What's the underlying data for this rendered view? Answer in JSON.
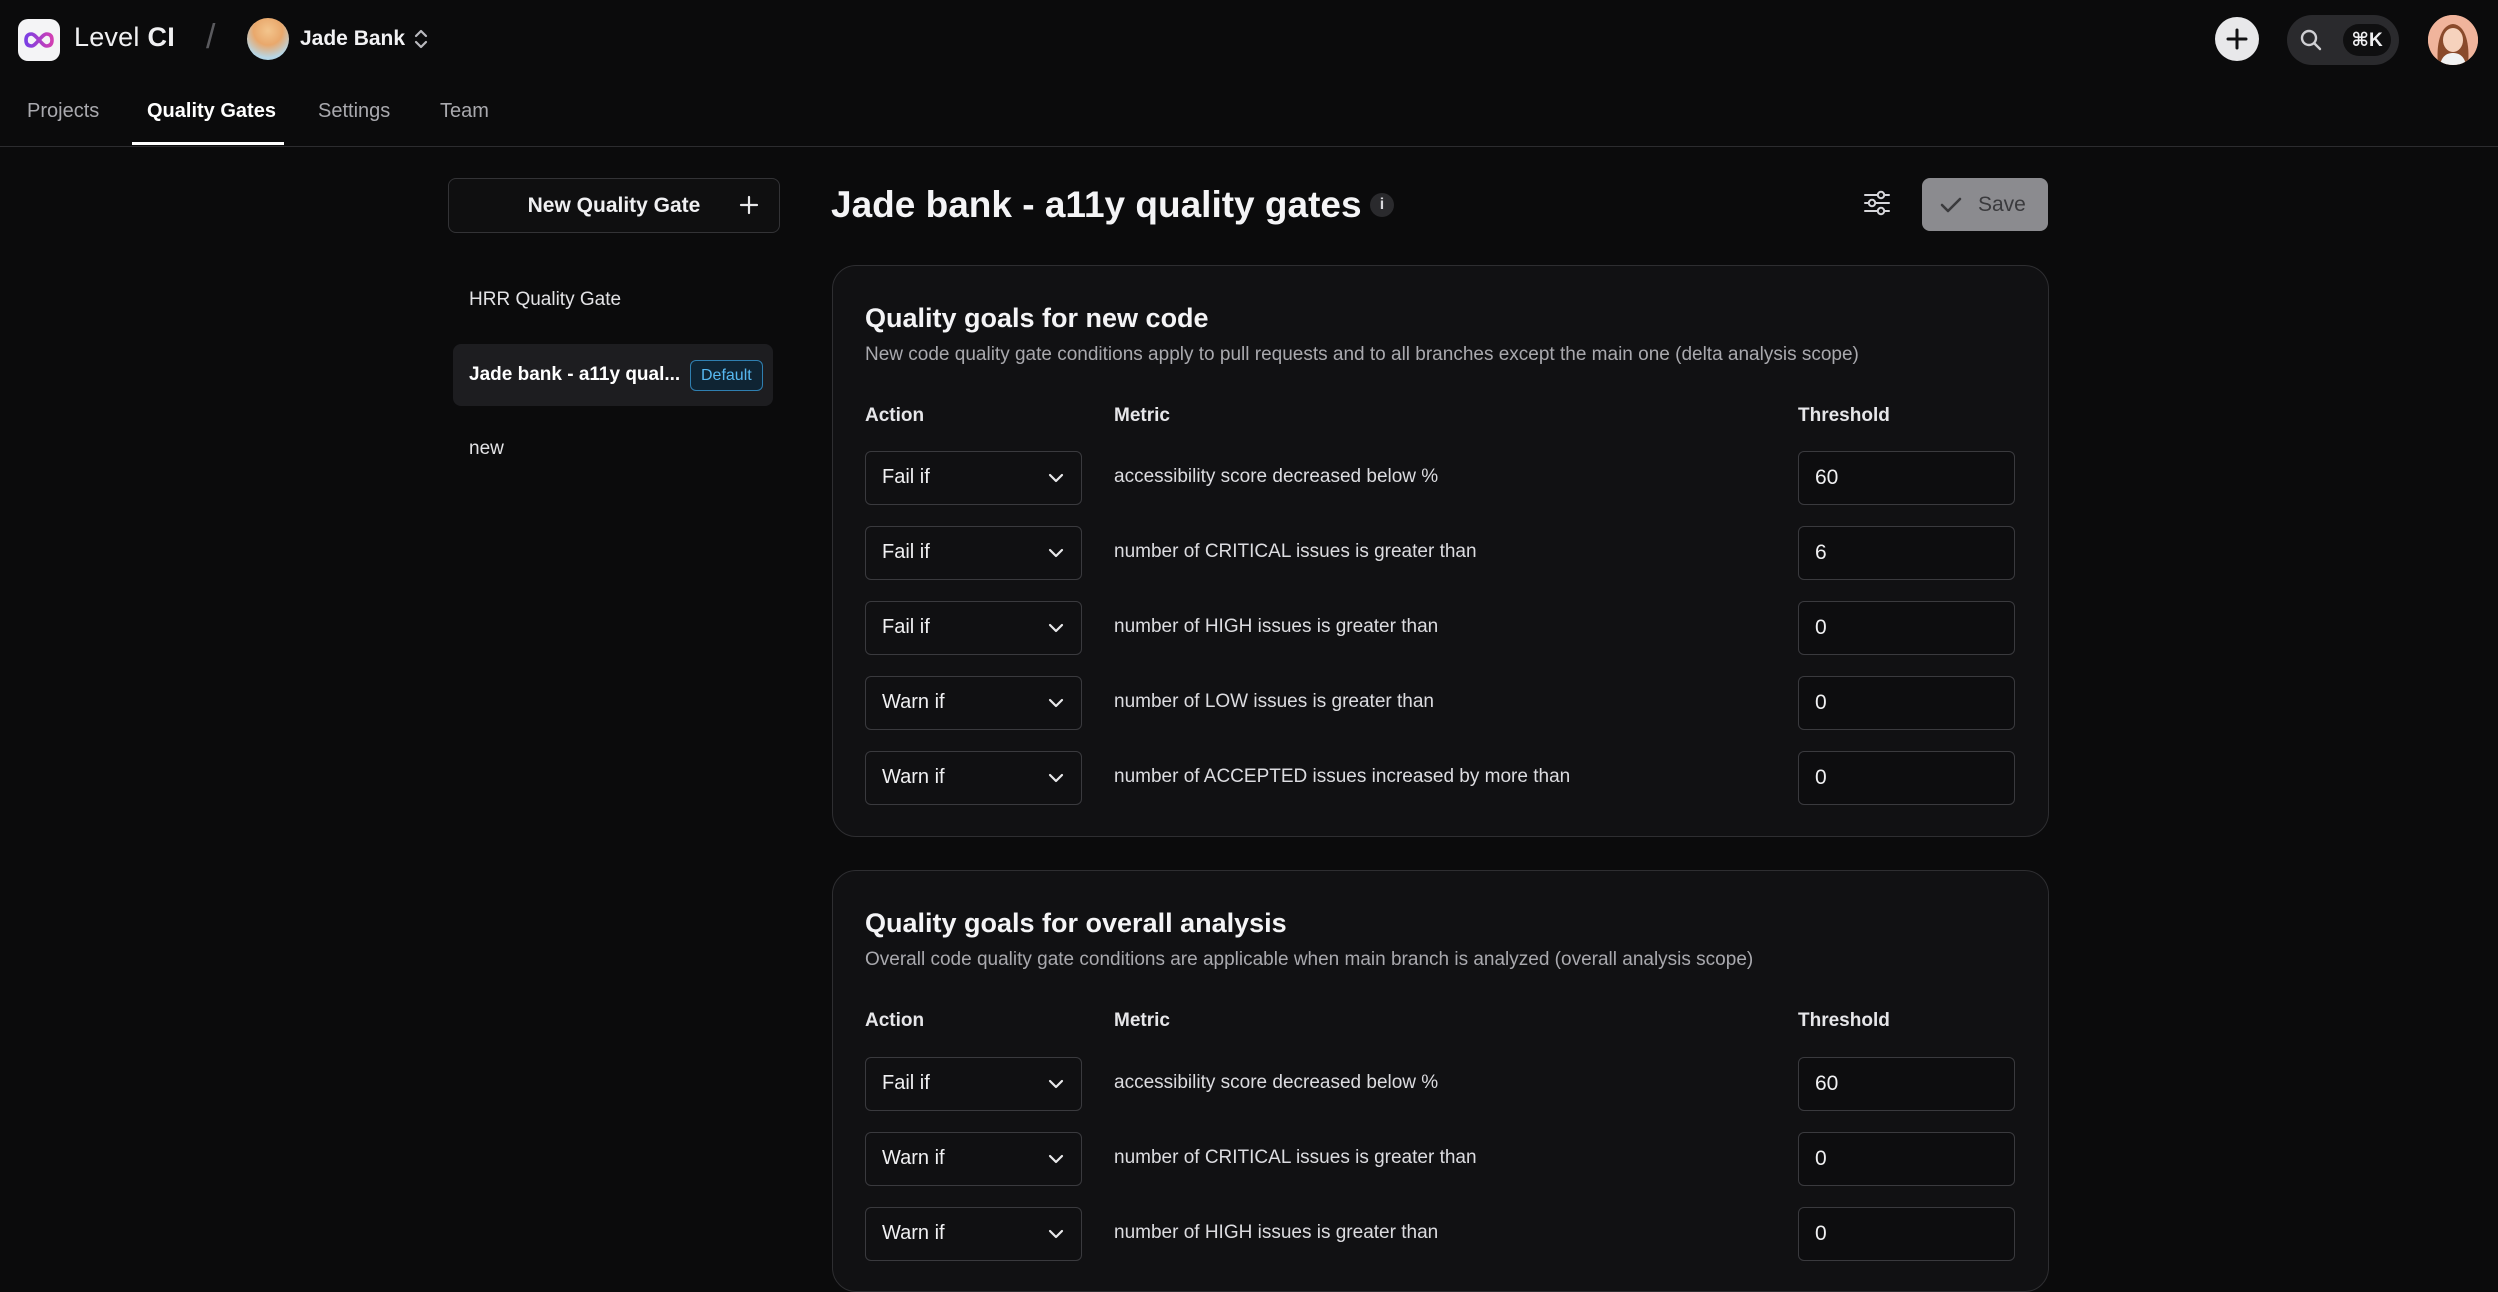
{
  "app": {
    "name_plain": "Level",
    "name_bold": "CI"
  },
  "org": {
    "name": "Jade Bank"
  },
  "search": {
    "shortcut": "⌘K"
  },
  "nav": {
    "tabs": [
      "Projects",
      "Quality Gates",
      "Settings",
      "Team"
    ],
    "active": "Quality Gates"
  },
  "sidebar": {
    "new_button": "New Quality Gate",
    "items": [
      {
        "label": "HRR Quality Gate"
      },
      {
        "label": "Jade bank - a11y qual...",
        "badge": "Default",
        "active": true
      },
      {
        "label": "new"
      }
    ]
  },
  "page": {
    "title": "Jade bank - a11y quality gates",
    "info": "i",
    "save_label": "Save"
  },
  "sections": [
    {
      "title": "Quality goals for new code",
      "description": "New code quality gate conditions apply to pull requests and to all branches except the main one (delta analysis scope)",
      "headers": {
        "action": "Action",
        "metric": "Metric",
        "threshold": "Threshold"
      },
      "rows": [
        {
          "action": "Fail if",
          "metric": "accessibility score decreased below %",
          "threshold": "60"
        },
        {
          "action": "Fail if",
          "metric": "number of CRITICAL issues is greater than",
          "threshold": "6"
        },
        {
          "action": "Fail if",
          "metric": "number of HIGH issues is greater than",
          "threshold": "0"
        },
        {
          "action": "Warn if",
          "metric": "number of LOW issues is greater than",
          "threshold": "0"
        },
        {
          "action": "Warn if",
          "metric": "number of ACCEPTED issues increased by more than",
          "threshold": "0"
        }
      ]
    },
    {
      "title": "Quality goals for overall analysis",
      "description": "Overall code quality gate conditions are applicable when main branch is analyzed (overall analysis scope)",
      "headers": {
        "action": "Action",
        "metric": "Metric",
        "threshold": "Threshold"
      },
      "rows": [
        {
          "action": "Fail if",
          "metric": "accessibility score decreased below %",
          "threshold": "60"
        },
        {
          "action": "Warn if",
          "metric": "number of CRITICAL issues is greater than",
          "threshold": "0"
        },
        {
          "action": "Warn if",
          "metric": "number of HIGH issues is greater than",
          "threshold": "0"
        }
      ]
    }
  ]
}
